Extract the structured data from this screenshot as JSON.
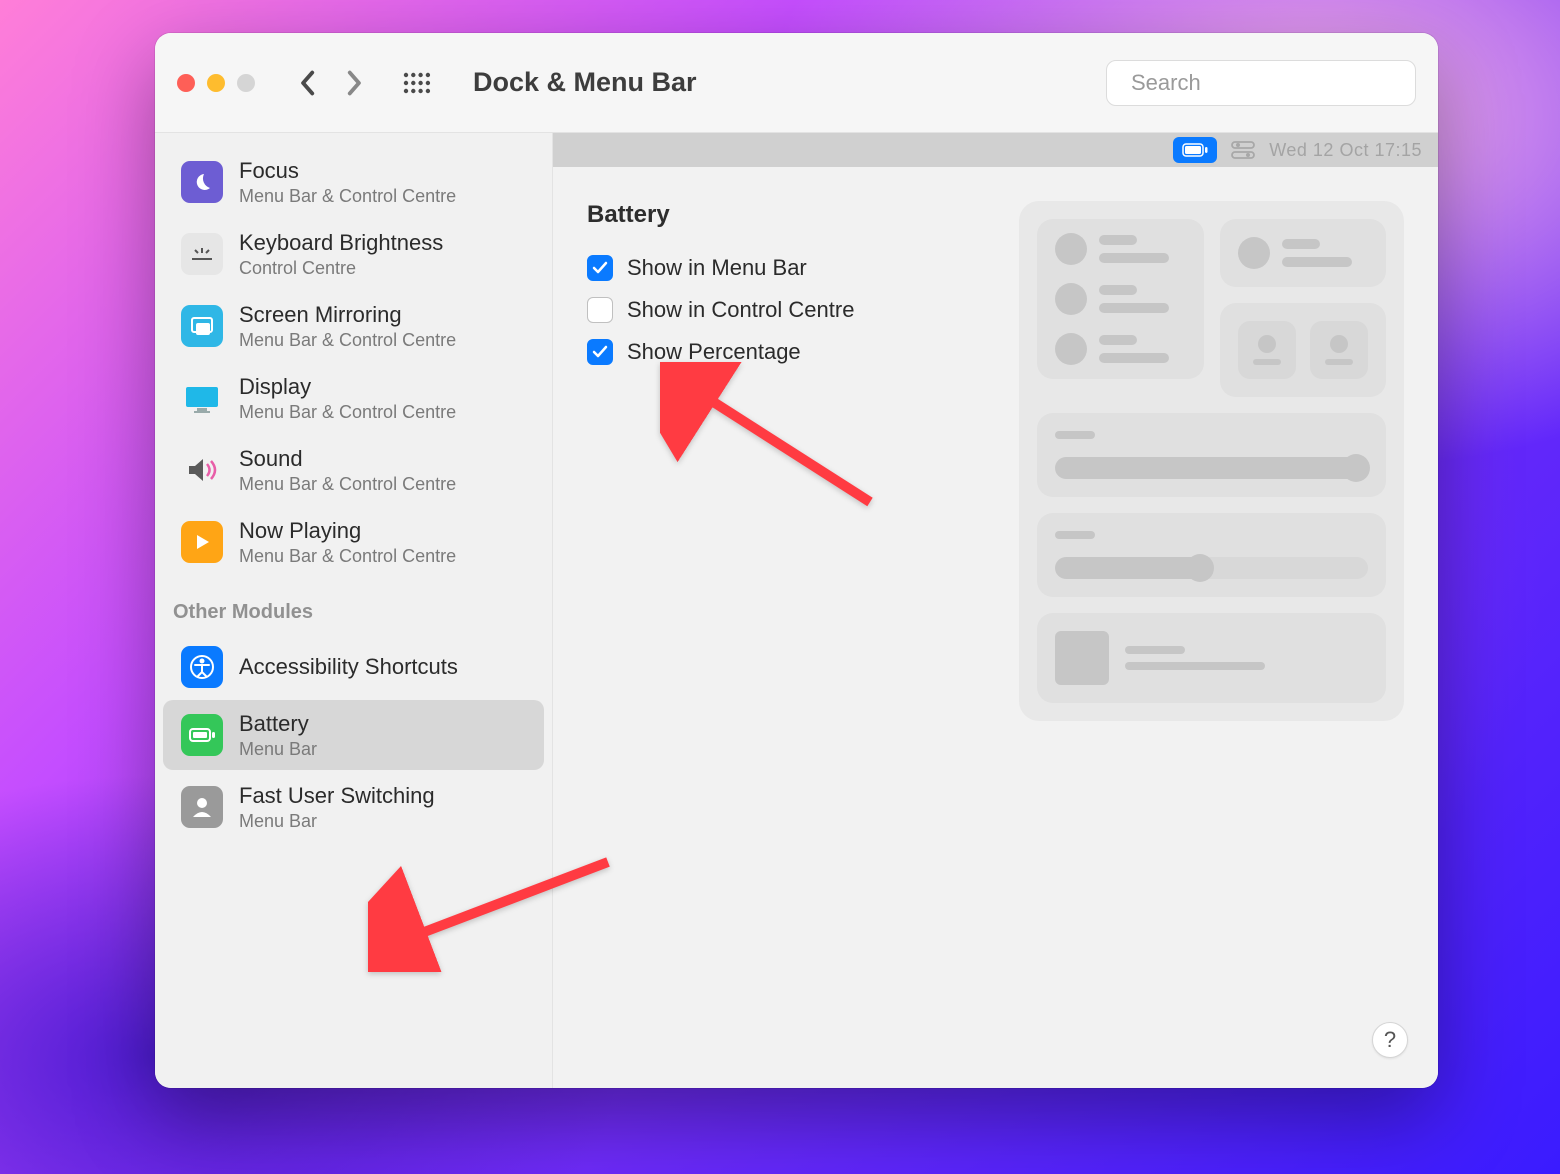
{
  "window": {
    "title": "Dock & Menu Bar"
  },
  "search": {
    "placeholder": "Search"
  },
  "menubar_preview": {
    "date_time": "Wed 12 Oct  17:15"
  },
  "sidebar": {
    "items": [
      {
        "label": "Focus",
        "sub": "Menu Bar & Control Centre"
      },
      {
        "label": "Keyboard Brightness",
        "sub": "Control Centre"
      },
      {
        "label": "Screen Mirroring",
        "sub": "Menu Bar & Control Centre"
      },
      {
        "label": "Display",
        "sub": "Menu Bar & Control Centre"
      },
      {
        "label": "Sound",
        "sub": "Menu Bar & Control Centre"
      },
      {
        "label": "Now Playing",
        "sub": "Menu Bar & Control Centre"
      }
    ],
    "section_header": "Other Modules",
    "other_items": [
      {
        "label": "Accessibility Shortcuts",
        "sub": ""
      },
      {
        "label": "Battery",
        "sub": "Menu Bar"
      },
      {
        "label": "Fast User Switching",
        "sub": "Menu Bar"
      }
    ]
  },
  "settings": {
    "title": "Battery",
    "options": [
      {
        "label": "Show in Menu Bar",
        "checked": true
      },
      {
        "label": "Show in Control Centre",
        "checked": false
      },
      {
        "label": "Show Percentage",
        "checked": true
      }
    ]
  },
  "help": {
    "label": "?"
  }
}
